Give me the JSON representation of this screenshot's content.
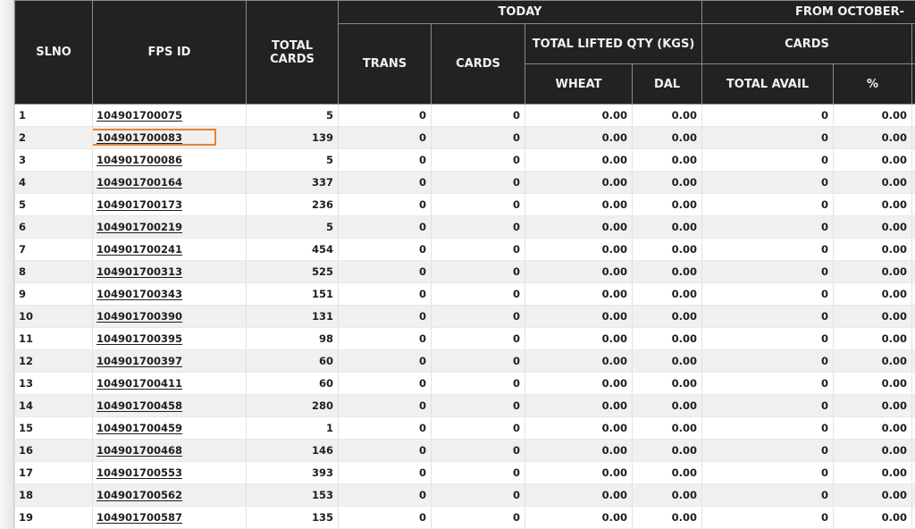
{
  "accent_colors": {
    "header_bg": "#222222",
    "highlight_box": "#e8832f",
    "row_alt": "#f0f0f0"
  },
  "header": {
    "slno": "SLNO",
    "fps_id": "FPS ID",
    "total_cards": "TOTAL CARDS",
    "today": "TODAY",
    "trans": "TRANS",
    "cards": "CARDS",
    "total_lifted_qty": "TOTAL LIFTED QTY (KGS)",
    "wheat": "WHEAT",
    "dal": "DAL",
    "from_october": "FROM OCTOBER-",
    "cards_group": "CARDS",
    "total_avail": "TOTAL AVAIL",
    "percent": "%"
  },
  "highlighted_fps_id": "104901700083",
  "rows": [
    {
      "slno": "1",
      "fps_id": "104901700075",
      "total_cards": "5",
      "trans": "0",
      "cards": "0",
      "wheat": "0.00",
      "dal": "0.00",
      "total_avail": "0",
      "percent": "0.00"
    },
    {
      "slno": "2",
      "fps_id": "104901700083",
      "total_cards": "139",
      "trans": "0",
      "cards": "0",
      "wheat": "0.00",
      "dal": "0.00",
      "total_avail": "0",
      "percent": "0.00"
    },
    {
      "slno": "3",
      "fps_id": "104901700086",
      "total_cards": "5",
      "trans": "0",
      "cards": "0",
      "wheat": "0.00",
      "dal": "0.00",
      "total_avail": "0",
      "percent": "0.00"
    },
    {
      "slno": "4",
      "fps_id": "104901700164",
      "total_cards": "337",
      "trans": "0",
      "cards": "0",
      "wheat": "0.00",
      "dal": "0.00",
      "total_avail": "0",
      "percent": "0.00"
    },
    {
      "slno": "5",
      "fps_id": "104901700173",
      "total_cards": "236",
      "trans": "0",
      "cards": "0",
      "wheat": "0.00",
      "dal": "0.00",
      "total_avail": "0",
      "percent": "0.00"
    },
    {
      "slno": "6",
      "fps_id": "104901700219",
      "total_cards": "5",
      "trans": "0",
      "cards": "0",
      "wheat": "0.00",
      "dal": "0.00",
      "total_avail": "0",
      "percent": "0.00"
    },
    {
      "slno": "7",
      "fps_id": "104901700241",
      "total_cards": "454",
      "trans": "0",
      "cards": "0",
      "wheat": "0.00",
      "dal": "0.00",
      "total_avail": "0",
      "percent": "0.00"
    },
    {
      "slno": "8",
      "fps_id": "104901700313",
      "total_cards": "525",
      "trans": "0",
      "cards": "0",
      "wheat": "0.00",
      "dal": "0.00",
      "total_avail": "0",
      "percent": "0.00"
    },
    {
      "slno": "9",
      "fps_id": "104901700343",
      "total_cards": "151",
      "trans": "0",
      "cards": "0",
      "wheat": "0.00",
      "dal": "0.00",
      "total_avail": "0",
      "percent": "0.00"
    },
    {
      "slno": "10",
      "fps_id": "104901700390",
      "total_cards": "131",
      "trans": "0",
      "cards": "0",
      "wheat": "0.00",
      "dal": "0.00",
      "total_avail": "0",
      "percent": "0.00"
    },
    {
      "slno": "11",
      "fps_id": "104901700395",
      "total_cards": "98",
      "trans": "0",
      "cards": "0",
      "wheat": "0.00",
      "dal": "0.00",
      "total_avail": "0",
      "percent": "0.00"
    },
    {
      "slno": "12",
      "fps_id": "104901700397",
      "total_cards": "60",
      "trans": "0",
      "cards": "0",
      "wheat": "0.00",
      "dal": "0.00",
      "total_avail": "0",
      "percent": "0.00"
    },
    {
      "slno": "13",
      "fps_id": "104901700411",
      "total_cards": "60",
      "trans": "0",
      "cards": "0",
      "wheat": "0.00",
      "dal": "0.00",
      "total_avail": "0",
      "percent": "0.00"
    },
    {
      "slno": "14",
      "fps_id": "104901700458",
      "total_cards": "280",
      "trans": "0",
      "cards": "0",
      "wheat": "0.00",
      "dal": "0.00",
      "total_avail": "0",
      "percent": "0.00"
    },
    {
      "slno": "15",
      "fps_id": "104901700459",
      "total_cards": "1",
      "trans": "0",
      "cards": "0",
      "wheat": "0.00",
      "dal": "0.00",
      "total_avail": "0",
      "percent": "0.00"
    },
    {
      "slno": "16",
      "fps_id": "104901700468",
      "total_cards": "146",
      "trans": "0",
      "cards": "0",
      "wheat": "0.00",
      "dal": "0.00",
      "total_avail": "0",
      "percent": "0.00"
    },
    {
      "slno": "17",
      "fps_id": "104901700553",
      "total_cards": "393",
      "trans": "0",
      "cards": "0",
      "wheat": "0.00",
      "dal": "0.00",
      "total_avail": "0",
      "percent": "0.00"
    },
    {
      "slno": "18",
      "fps_id": "104901700562",
      "total_cards": "153",
      "trans": "0",
      "cards": "0",
      "wheat": "0.00",
      "dal": "0.00",
      "total_avail": "0",
      "percent": "0.00"
    },
    {
      "slno": "19",
      "fps_id": "104901700587",
      "total_cards": "135",
      "trans": "0",
      "cards": "0",
      "wheat": "0.00",
      "dal": "0.00",
      "total_avail": "0",
      "percent": "0.00"
    }
  ]
}
